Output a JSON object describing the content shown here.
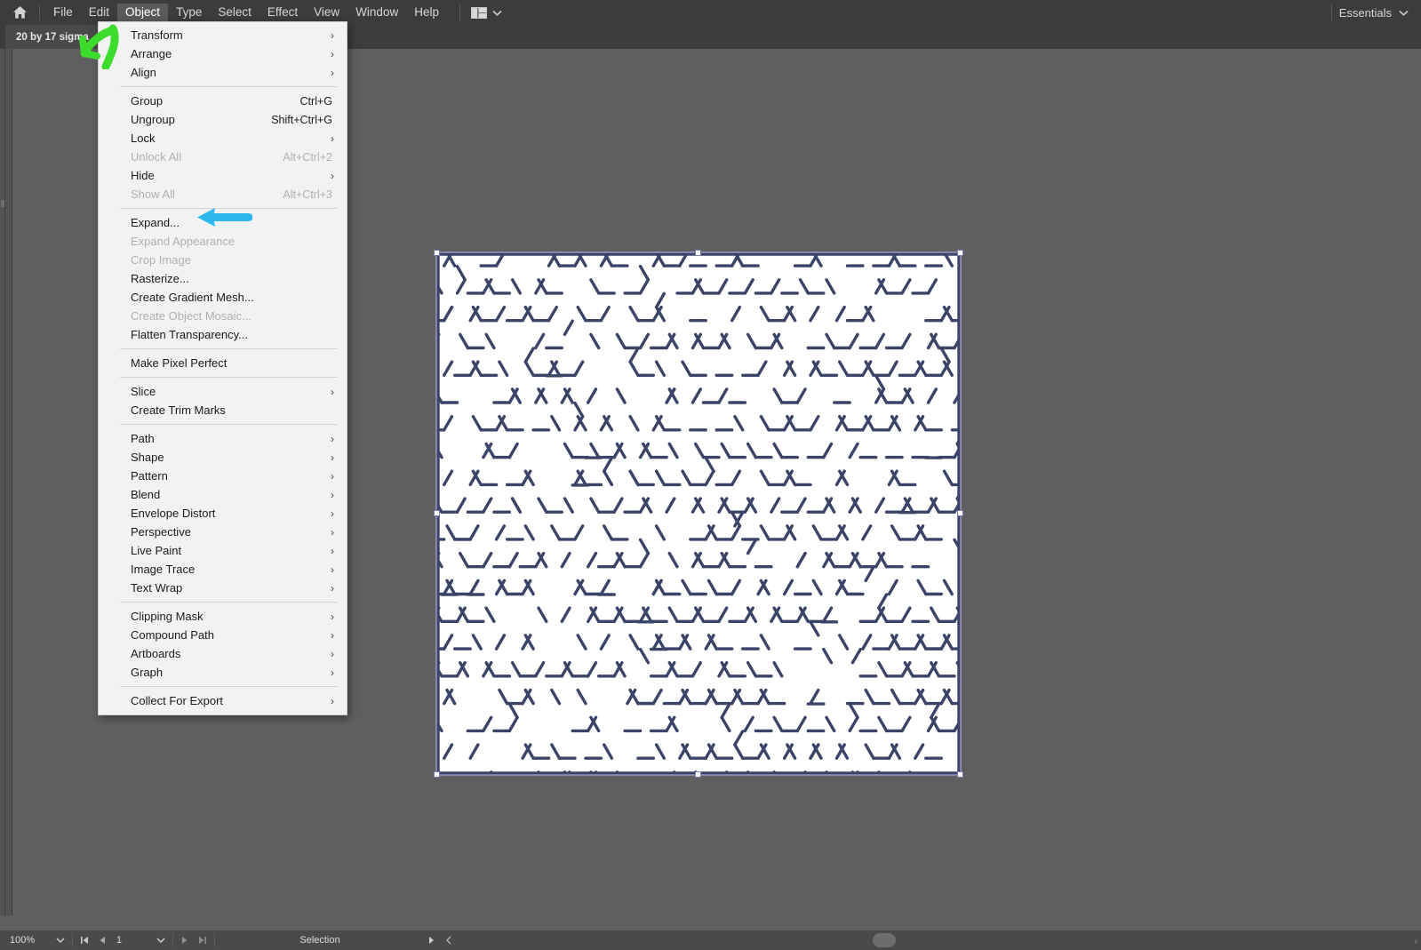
{
  "app": {
    "workspace_label": "Essentials",
    "home_icon": "home-icon",
    "arrange_icon": "arrange-documents-icon",
    "chevron_icon": "chevron-down-icon"
  },
  "menubar": {
    "items": [
      {
        "label": "File",
        "active": false
      },
      {
        "label": "Edit",
        "active": false
      },
      {
        "label": "Object",
        "active": true
      },
      {
        "label": "Type",
        "active": false
      },
      {
        "label": "Select",
        "active": false
      },
      {
        "label": "Effect",
        "active": false
      },
      {
        "label": "View",
        "active": false
      },
      {
        "label": "Window",
        "active": false
      },
      {
        "label": "Help",
        "active": false
      }
    ]
  },
  "document_tab": {
    "title": "20 by 17 sigma"
  },
  "object_menu": {
    "groups": [
      {
        "items": [
          {
            "label": "Transform",
            "shortcut": "",
            "submenu": true,
            "disabled": false
          },
          {
            "label": "Arrange",
            "shortcut": "",
            "submenu": true,
            "disabled": false
          },
          {
            "label": "Align",
            "shortcut": "",
            "submenu": true,
            "disabled": false
          }
        ]
      },
      {
        "items": [
          {
            "label": "Group",
            "shortcut": "Ctrl+G",
            "submenu": false,
            "disabled": false
          },
          {
            "label": "Ungroup",
            "shortcut": "Shift+Ctrl+G",
            "submenu": false,
            "disabled": false
          },
          {
            "label": "Lock",
            "shortcut": "",
            "submenu": true,
            "disabled": false
          },
          {
            "label": "Unlock All",
            "shortcut": "Alt+Ctrl+2",
            "submenu": false,
            "disabled": true
          },
          {
            "label": "Hide",
            "shortcut": "",
            "submenu": true,
            "disabled": false
          },
          {
            "label": "Show All",
            "shortcut": "Alt+Ctrl+3",
            "submenu": false,
            "disabled": true
          }
        ]
      },
      {
        "items": [
          {
            "label": "Expand...",
            "shortcut": "",
            "submenu": false,
            "disabled": false
          },
          {
            "label": "Expand Appearance",
            "shortcut": "",
            "submenu": false,
            "disabled": true
          },
          {
            "label": "Crop Image",
            "shortcut": "",
            "submenu": false,
            "disabled": true
          },
          {
            "label": "Rasterize...",
            "shortcut": "",
            "submenu": false,
            "disabled": false
          },
          {
            "label": "Create Gradient Mesh...",
            "shortcut": "",
            "submenu": false,
            "disabled": false
          },
          {
            "label": "Create Object Mosaic...",
            "shortcut": "",
            "submenu": false,
            "disabled": true
          },
          {
            "label": "Flatten Transparency...",
            "shortcut": "",
            "submenu": false,
            "disabled": false
          }
        ]
      },
      {
        "items": [
          {
            "label": "Make Pixel Perfect",
            "shortcut": "",
            "submenu": false,
            "disabled": false
          }
        ]
      },
      {
        "items": [
          {
            "label": "Slice",
            "shortcut": "",
            "submenu": true,
            "disabled": false
          },
          {
            "label": "Create Trim Marks",
            "shortcut": "",
            "submenu": false,
            "disabled": false
          }
        ]
      },
      {
        "items": [
          {
            "label": "Path",
            "shortcut": "",
            "submenu": true,
            "disabled": false
          },
          {
            "label": "Shape",
            "shortcut": "",
            "submenu": true,
            "disabled": false
          },
          {
            "label": "Pattern",
            "shortcut": "",
            "submenu": true,
            "disabled": false
          },
          {
            "label": "Blend",
            "shortcut": "",
            "submenu": true,
            "disabled": false
          },
          {
            "label": "Envelope Distort",
            "shortcut": "",
            "submenu": true,
            "disabled": false
          },
          {
            "label": "Perspective",
            "shortcut": "",
            "submenu": true,
            "disabled": false
          },
          {
            "label": "Live Paint",
            "shortcut": "",
            "submenu": true,
            "disabled": false
          },
          {
            "label": "Image Trace",
            "shortcut": "",
            "submenu": true,
            "disabled": false
          },
          {
            "label": "Text Wrap",
            "shortcut": "",
            "submenu": true,
            "disabled": false
          }
        ]
      },
      {
        "items": [
          {
            "label": "Clipping Mask",
            "shortcut": "",
            "submenu": true,
            "disabled": false
          },
          {
            "label": "Compound Path",
            "shortcut": "",
            "submenu": true,
            "disabled": false
          },
          {
            "label": "Artboards",
            "shortcut": "",
            "submenu": true,
            "disabled": false
          },
          {
            "label": "Graph",
            "shortcut": "",
            "submenu": true,
            "disabled": false
          }
        ]
      },
      {
        "items": [
          {
            "label": "Collect For Export",
            "shortcut": "",
            "submenu": true,
            "disabled": false
          }
        ]
      }
    ]
  },
  "annotations": [
    {
      "name": "green-arrow-annotation",
      "color": "#3ddb2b",
      "points_to": "document tab"
    },
    {
      "name": "blue-arrow-annotation",
      "color": "#2cb8ef",
      "points_to": "Expand... menu item"
    }
  ],
  "artwork": {
    "name": "hexagonal-maze",
    "stroke_color": "#3b4468",
    "background": "#ffffff",
    "selected": true
  },
  "statusbar": {
    "zoom_level": "100%",
    "page_number": "1",
    "tool_name": "Selection",
    "first_page_icon": "first-page-icon",
    "prev_page_icon": "prev-page-icon",
    "next_page_icon": "next-page-icon",
    "last_page_icon": "last-page-icon",
    "zoom_dropdown_icon": "chevron-down-icon",
    "page_dropdown_icon": "chevron-down-icon",
    "tool_menu_icon": "triangle-right-icon",
    "collapse_icon": "chevron-left-icon"
  }
}
